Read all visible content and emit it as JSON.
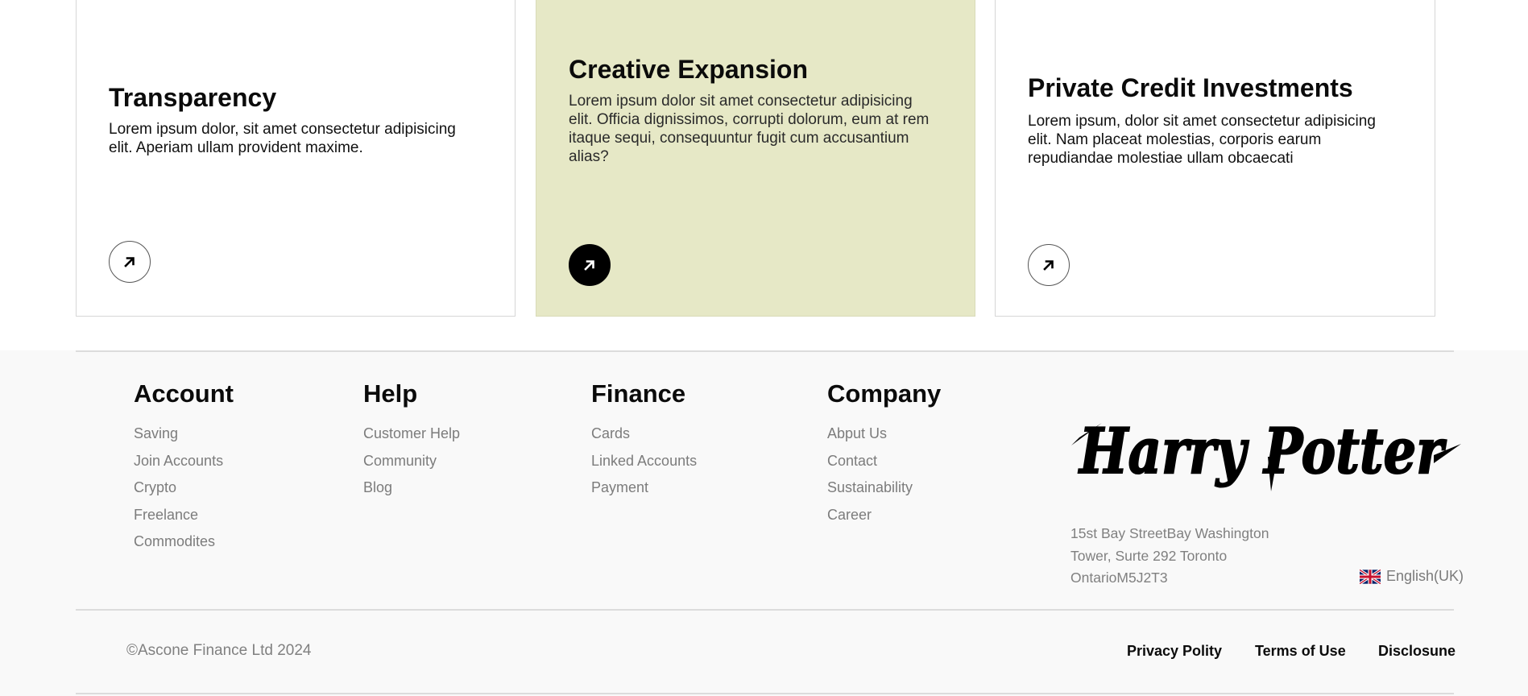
{
  "cards": [
    {
      "title": "Transparency",
      "text": "Lorem ipsum dolor, sit amet consectetur adipisicing elit. Aperiam ullam provident maxime."
    },
    {
      "title": "Creative Expansion",
      "text": "Lorem ipsum dolor sit amet consectetur adipisicing elit. Officia dignissimos, corrupti dolorum, eum at rem itaque sequi, consequuntur fugit cum accusantium alias?"
    },
    {
      "title": "Private Credit Investments",
      "text": "Lorem ipsum, dolor sit amet consectetur adipisicing elit. Nam placeat molestias, corporis earum repudiandae molestiae ullam obcaecati"
    }
  ],
  "cards_icon": "arrow-up-right-icon",
  "colors": {
    "highlight_card": "#e6e8c6",
    "footer_bg": "#f9f9f9",
    "link_gray": "#7c7c7c"
  },
  "footer": {
    "columns": [
      {
        "title": "Account",
        "links": [
          "Saving",
          "Join Accounts",
          "Crypto",
          "Freelance",
          "Commodites"
        ]
      },
      {
        "title": "Help",
        "links": [
          "Customer Help",
          "Community",
          "Blog"
        ]
      },
      {
        "title": "Finance",
        "links": [
          "Cards",
          "Linked Accounts",
          "Payment"
        ]
      },
      {
        "title": "Company",
        "links": [
          "Abput Us",
          "Contact",
          "Sustainability",
          "Career"
        ]
      }
    ],
    "logo_text": "Harry Potter",
    "address": [
      "15st Bay StreetBay Washington",
      "Tower, Surte 292 Toronto",
      "OntarioM5J2T3"
    ],
    "language": "English(UK)",
    "copyright": "©Ascone Finance Ltd 2024",
    "legal_links": [
      "Privacy Polity",
      "Terms of Use",
      "Disclosune"
    ]
  }
}
